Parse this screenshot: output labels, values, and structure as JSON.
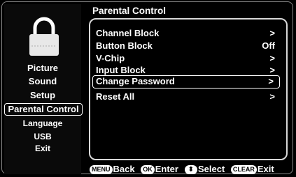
{
  "sidebar": {
    "items": [
      {
        "label": "Picture"
      },
      {
        "label": "Sound"
      },
      {
        "label": "Setup"
      },
      {
        "label": "Parental Control",
        "selected": true
      },
      {
        "label": "Language"
      },
      {
        "label": "USB"
      },
      {
        "label": "Exit"
      }
    ],
    "icon": "padlock-icon"
  },
  "main": {
    "title": "Parental Control",
    "menu": [
      {
        "label": "Channel Block",
        "value": ">"
      },
      {
        "label": "Button Block",
        "value": "Off"
      },
      {
        "label": "V-Chip",
        "value": ">"
      },
      {
        "label": "Input Block",
        "value": ">"
      },
      {
        "label": "Change Password",
        "value": ">",
        "selected": true
      },
      {
        "label": "Reset All",
        "value": ">"
      }
    ]
  },
  "footer": {
    "menu_key": "MENU",
    "back_label": "Back",
    "ok_key": "OK",
    "enter_label": "Enter",
    "updown_key": "⬍",
    "select_label": "Select",
    "clear_key": "CLEAR",
    "exit_label": "Exit"
  }
}
